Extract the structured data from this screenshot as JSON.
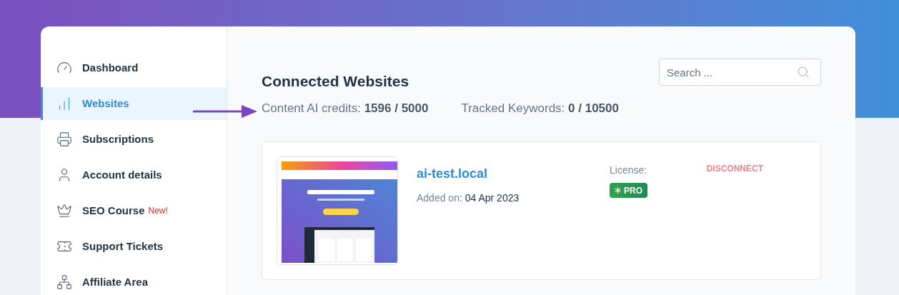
{
  "sidebar": {
    "items": [
      {
        "label": "Dashboard",
        "selected": false
      },
      {
        "label": "Websites",
        "selected": true
      },
      {
        "label": "Subscriptions",
        "selected": false
      },
      {
        "label": "Account details",
        "selected": false
      },
      {
        "label": "SEO Course",
        "selected": false,
        "badge": "New!"
      },
      {
        "label": "Support Tickets",
        "selected": false
      },
      {
        "label": "Affiliate Area",
        "selected": false
      }
    ]
  },
  "main": {
    "title": "Connected Websites",
    "search": {
      "placeholder": "Search ..."
    },
    "stats": [
      {
        "label": "Content AI credits:",
        "value": "1596 / 5000"
      },
      {
        "label": "Tracked Keywords:",
        "value": "0 / 10500"
      }
    ],
    "websites": [
      {
        "domain": "ai-test.local",
        "added_label": "Added on:",
        "added_date": "04 Apr 2023",
        "license_label": "License:",
        "license": "PRO",
        "action": "DISCONNECT"
      }
    ]
  }
}
